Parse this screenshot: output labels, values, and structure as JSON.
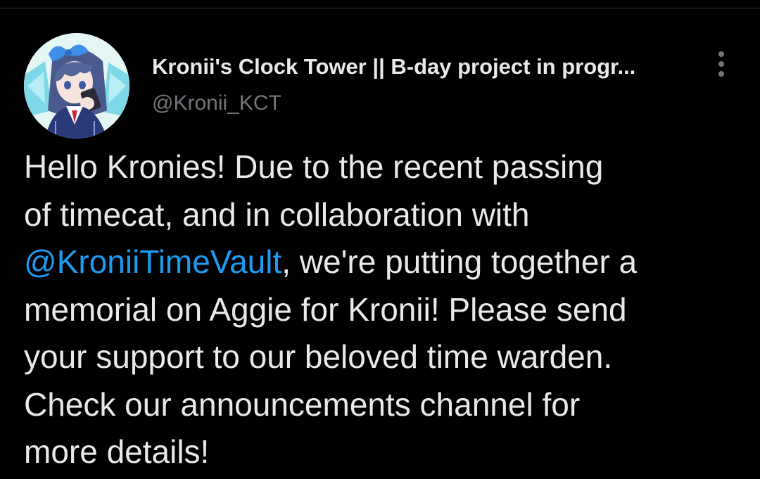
{
  "tweet": {
    "author": {
      "display_name": "Kronii's Clock Tower || B-day project in progr...",
      "handle": "@Kronii_KCT",
      "avatar_icon": "anime-character-avatar"
    },
    "more_icon": "more-vertical-icon",
    "body": {
      "line1": "Hello Kronies! Due to the recent passing",
      "line2": "of timecat, and in collaboration with",
      "line3_mention": "@KroniiTimeVault",
      "line3_rest": ", we're putting together a",
      "line4": "memorial on Aggie for Kronii! Please send",
      "line5": "your support to our beloved time warden.",
      "line6": "Check our announcements channel for",
      "line7": "more details!"
    }
  },
  "colors": {
    "background": "#000000",
    "text_primary": "#e7e9ea",
    "text_secondary": "#71767b",
    "link": "#1d9bf0",
    "divider": "#2f3336"
  }
}
